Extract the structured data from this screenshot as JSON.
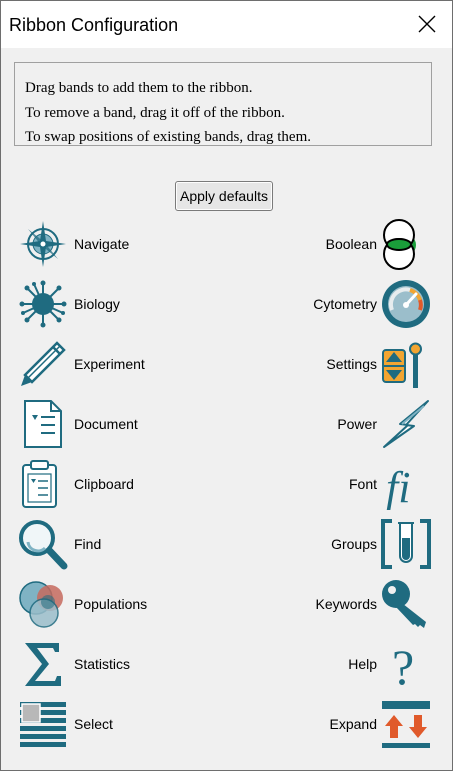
{
  "window": {
    "title": "Ribbon Configuration",
    "close_icon": "close-icon"
  },
  "instructions": [
    "Drag bands to add them to the ribbon.",
    "To remove a band, drag it off of the ribbon.",
    "To swap positions of existing bands, drag them."
  ],
  "apply_defaults_label": "Apply defaults",
  "left_bands": [
    {
      "label": "Navigate",
      "icon": "compass-icon"
    },
    {
      "label": "Biology",
      "icon": "cell-icon"
    },
    {
      "label": "Experiment",
      "icon": "pencil-icon"
    },
    {
      "label": "Document",
      "icon": "document-icon"
    },
    {
      "label": "Clipboard",
      "icon": "clipboard-icon"
    },
    {
      "label": "Find",
      "icon": "magnifier-icon"
    },
    {
      "label": "Populations",
      "icon": "populations-icon"
    },
    {
      "label": "Statistics",
      "icon": "sigma-icon"
    },
    {
      "label": "Select",
      "icon": "select-icon"
    }
  ],
  "right_bands": [
    {
      "label": "Boolean",
      "icon": "venn-icon"
    },
    {
      "label": "Cytometry",
      "icon": "gauge-icon"
    },
    {
      "label": "Settings",
      "icon": "settings-slider-icon"
    },
    {
      "label": "Power",
      "icon": "lightning-icon"
    },
    {
      "label": "Font",
      "icon": "font-fi-icon"
    },
    {
      "label": "Groups",
      "icon": "test-tube-icon"
    },
    {
      "label": "Keywords",
      "icon": "key-icon"
    },
    {
      "label": "Help",
      "icon": "question-mark-icon"
    },
    {
      "label": "Expand",
      "icon": "expand-arrows-icon"
    }
  ],
  "colors": {
    "icon_teal": "#1f6b80",
    "icon_light_teal": "#7fb3c4",
    "boolean_green": "#1a9e3a",
    "expand_orange": "#e05a2b",
    "settings_orange": "#f2a531"
  }
}
